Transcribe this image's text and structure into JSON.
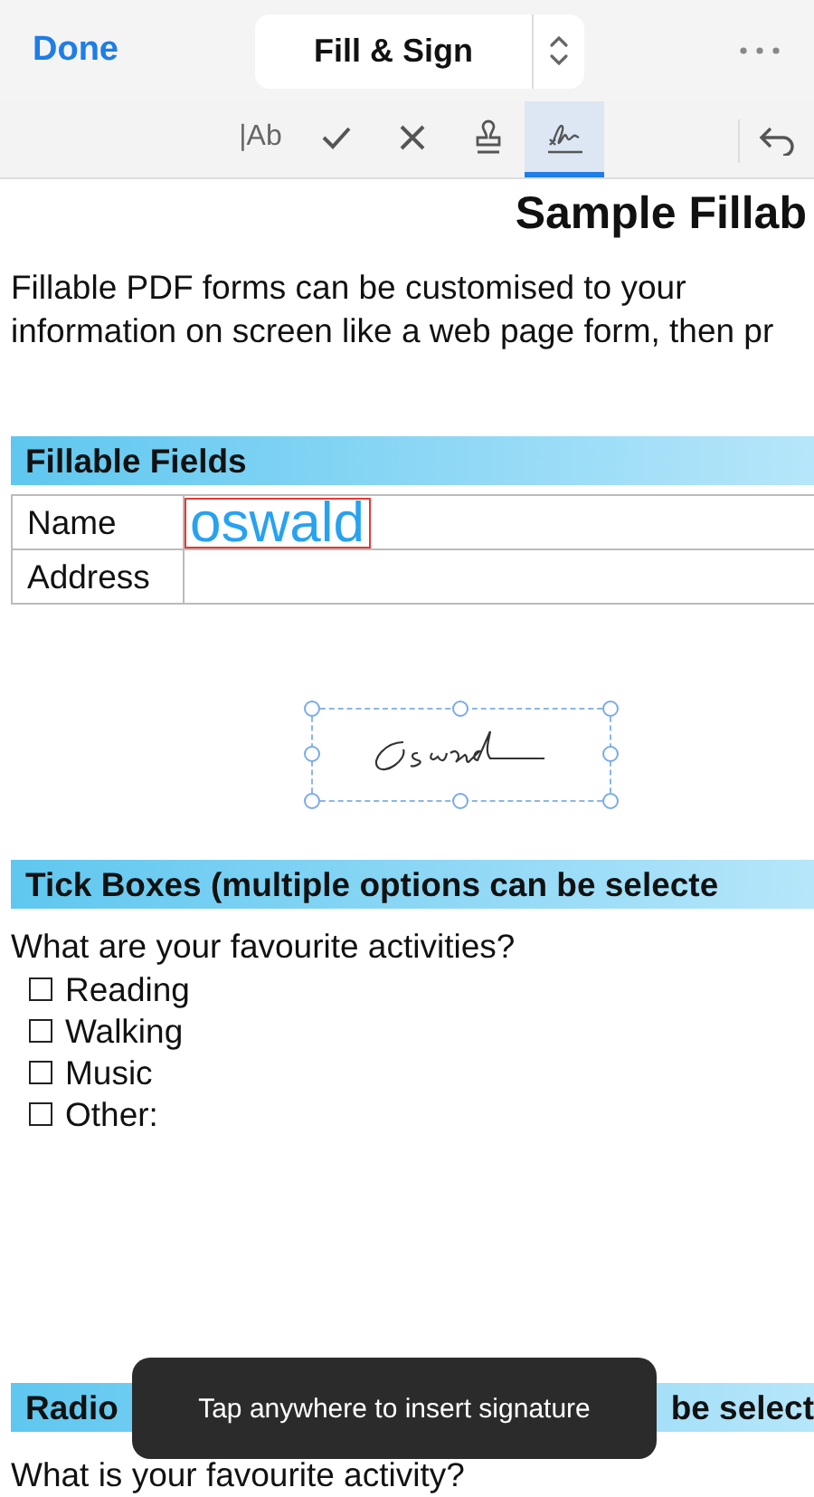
{
  "header": {
    "done": "Done",
    "mode": "Fill & Sign"
  },
  "tools": [
    {
      "kind": "text",
      "label": "|Ab",
      "selected": false
    },
    {
      "kind": "check",
      "selected": false
    },
    {
      "kind": "cross",
      "selected": false
    },
    {
      "kind": "stamp",
      "selected": false
    },
    {
      "kind": "signature",
      "selected": true
    }
  ],
  "document": {
    "title": "Sample Fillab",
    "intro": [
      "Fillable PDF forms can be customised to your",
      "information on screen like a web page form, then pr"
    ],
    "fields_heading": "Fillable Fields",
    "fields": [
      {
        "label": "Name",
        "value": "oswald"
      },
      {
        "label": "Address"
      }
    ],
    "ticks_heading": "Tick Boxes (multiple options can be selecte",
    "ticks_question": "What are your favourite activities?",
    "ticks": [
      {
        "label": "Reading",
        "checked": false
      },
      {
        "label": "Walking",
        "checked": false
      },
      {
        "label": "Music",
        "checked": false
      },
      {
        "label": "Other:",
        "checked": false
      }
    ],
    "radio_heading_start": "Radio",
    "radio_heading_end": "be select",
    "radio_question": "What is your favourite activity?"
  },
  "toast": "Tap anywhere to insert signature"
}
